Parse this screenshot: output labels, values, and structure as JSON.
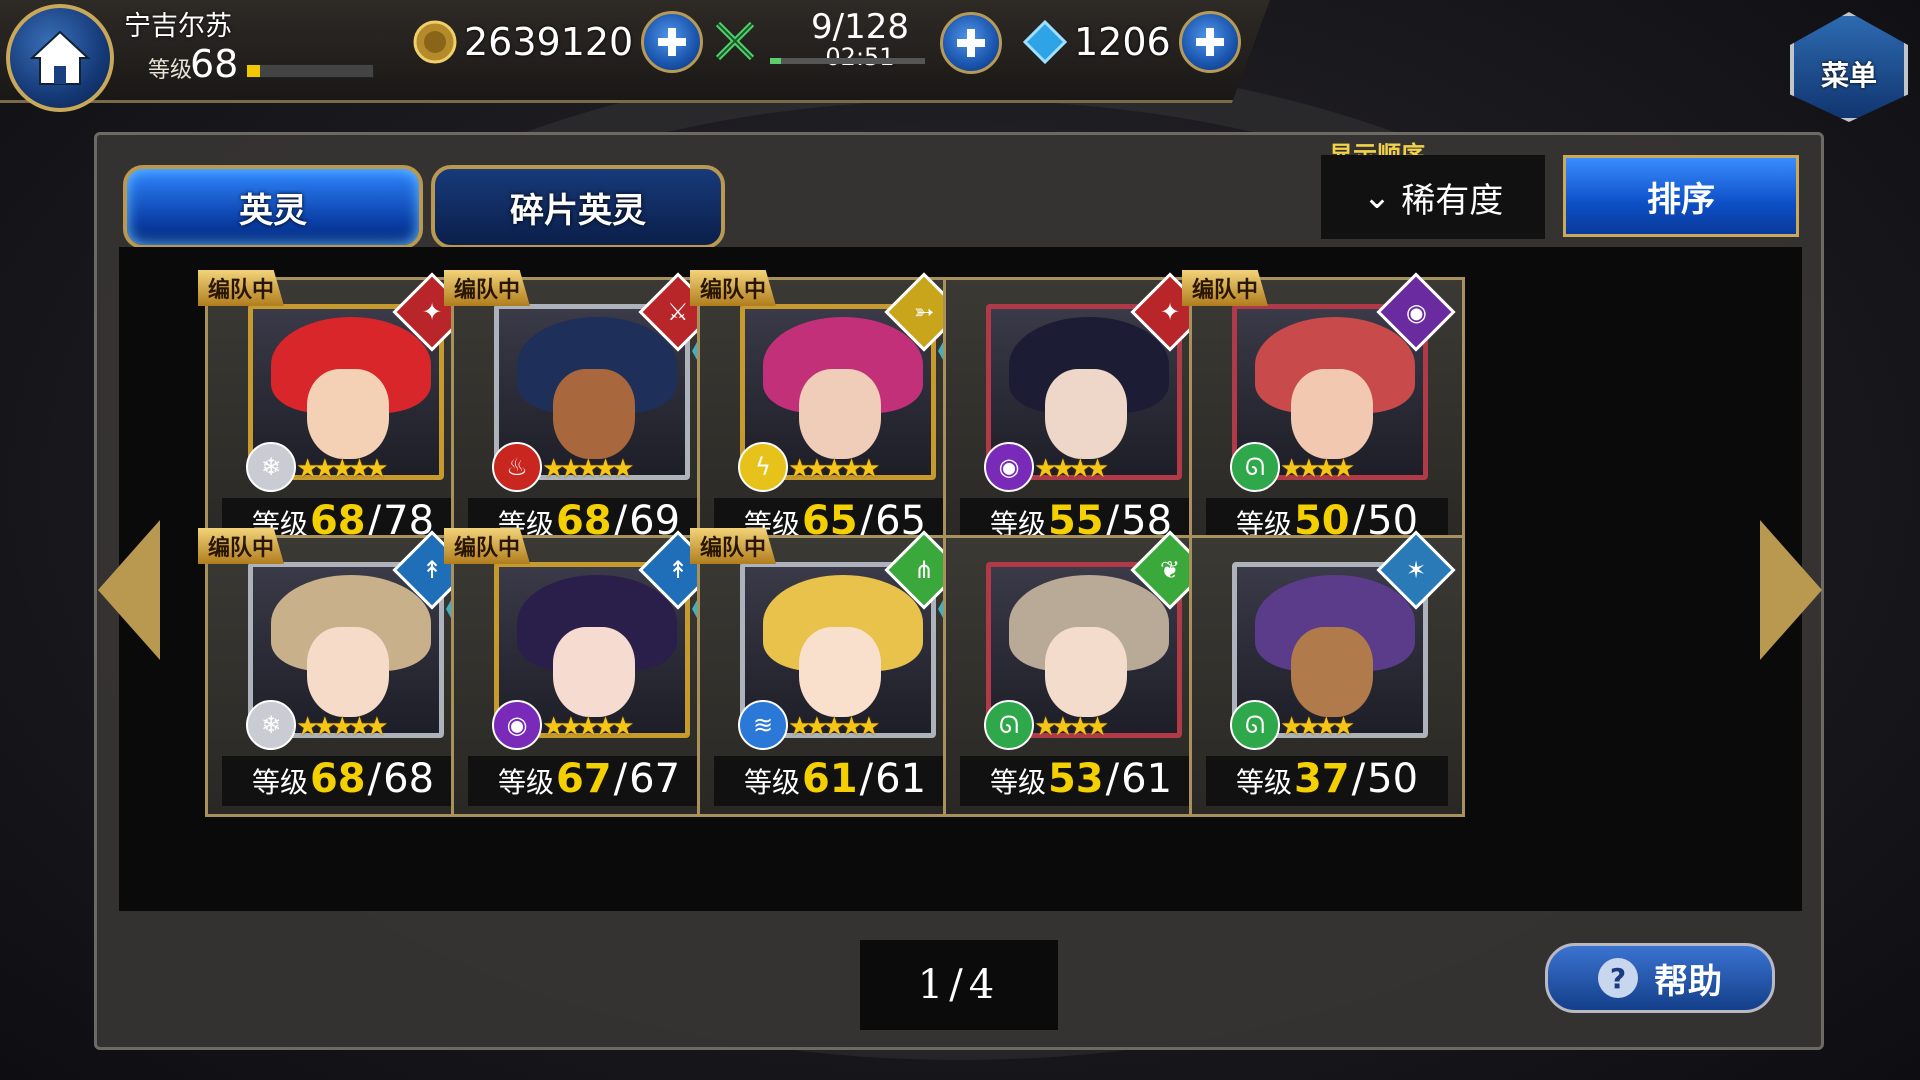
{
  "header": {
    "player_name": "宁吉尔苏",
    "level_label": "等级",
    "level": "68",
    "exp_fraction": 0.1,
    "gold": "2639120",
    "stamina": "9/128",
    "stamina_timer": "02:51",
    "stamina_fraction": 0.07,
    "gems": "1206",
    "menu_label": "菜单"
  },
  "tabs": [
    {
      "label": "英灵",
      "active": true
    },
    {
      "label": "碎片英灵",
      "active": false
    }
  ],
  "sort": {
    "order_label": "显示顺序",
    "selected": "稀有度",
    "button_label": "排序"
  },
  "team_tag": "编队中",
  "level_prefix": "等级",
  "cards": [
    {
      "in_team": true,
      "level": "68",
      "max": "78",
      "stars": 5,
      "frame": "gold",
      "hair": "#d8262a",
      "skin": "#f4d0b4",
      "class_color": "#b8262a",
      "class_icon": "✦",
      "element_color": "#c9ccd2",
      "element_icon": "❄",
      "book": false
    },
    {
      "in_team": true,
      "level": "68",
      "max": "69",
      "stars": 5,
      "frame": "silver",
      "hair": "#1e2f5a",
      "skin": "#a8673c",
      "class_color": "#b8262a",
      "class_icon": "⚔",
      "element_color": "#c8261e",
      "element_icon": "♨",
      "book": true
    },
    {
      "in_team": true,
      "level": "65",
      "max": "65",
      "stars": 5,
      "frame": "gold",
      "hair": "#c2307a",
      "skin": "#f0cdb8",
      "class_color": "#c9a51c",
      "class_icon": "➳",
      "element_color": "#e6c21a",
      "element_icon": "ϟ",
      "book": true
    },
    {
      "in_team": false,
      "level": "55",
      "max": "58",
      "stars": 4,
      "frame": "red",
      "hair": "#1c1c34",
      "skin": "#eed6c8",
      "class_color": "#b8262a",
      "class_icon": "✦",
      "element_color": "#7a2ab8",
      "element_icon": "◉",
      "book": false
    },
    {
      "in_team": true,
      "level": "50",
      "max": "50",
      "stars": 4,
      "frame": "red",
      "hair": "#c84a4a",
      "skin": "#f2c8b0",
      "class_color": "#6a2aa0",
      "class_icon": "◉",
      "element_color": "#2ea84a",
      "element_icon": "ᘏ",
      "book": false
    },
    {
      "in_team": true,
      "level": "68",
      "max": "68",
      "stars": 5,
      "frame": "silver",
      "hair": "#c8b08a",
      "skin": "#f6dcc8",
      "class_color": "#1f6fb8",
      "class_icon": "↟",
      "element_color": "#c9ccd2",
      "element_icon": "❄",
      "book": true
    },
    {
      "in_team": true,
      "level": "67",
      "max": "67",
      "stars": 5,
      "frame": "gold",
      "hair": "#2a1f4a",
      "skin": "#f6dcd0",
      "class_color": "#1f6fb8",
      "class_icon": "↟",
      "element_color": "#7a2ab8",
      "element_icon": "◉",
      "book": true
    },
    {
      "in_team": true,
      "level": "61",
      "max": "61",
      "stars": 5,
      "frame": "silver",
      "hair": "#e8c24a",
      "skin": "#f8e0cc",
      "class_color": "#3aa83a",
      "class_icon": "⋔",
      "element_color": "#2a78d8",
      "element_icon": "≋",
      "book": true
    },
    {
      "in_team": false,
      "level": "53",
      "max": "61",
      "stars": 4,
      "frame": "red",
      "hair": "#b8aa96",
      "skin": "#f4dccc",
      "class_color": "#3aa83a",
      "class_icon": "❦",
      "element_color": "#2ea84a",
      "element_icon": "ᘏ",
      "book": false
    },
    {
      "in_team": false,
      "level": "37",
      "max": "50",
      "stars": 4,
      "frame": "silver",
      "hair": "#5a3c8a",
      "skin": "#b07a4a",
      "class_color": "#2a7ab8",
      "class_icon": "✶",
      "element_color": "#2ea84a",
      "element_icon": "ᘏ",
      "book": false
    }
  ],
  "pager": {
    "current": "1",
    "sep": "/",
    "total": "4"
  },
  "help_label": "帮助"
}
